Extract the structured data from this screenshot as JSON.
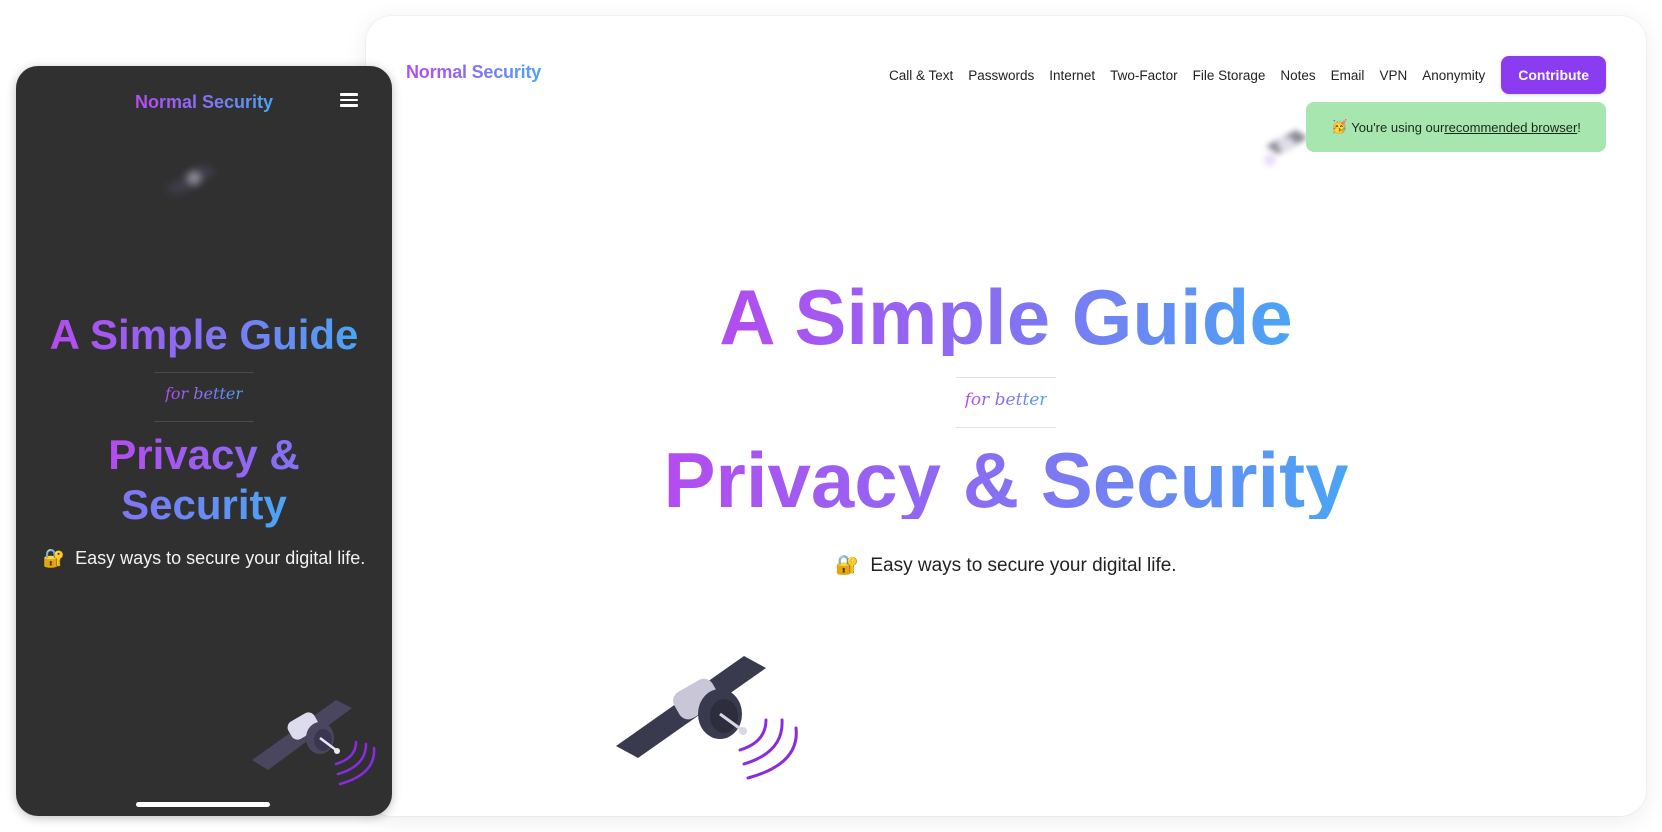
{
  "desktop": {
    "logo": "Normal Security",
    "nav": [
      "Call & Text",
      "Passwords",
      "Internet",
      "Two-Factor",
      "File Storage",
      "Notes",
      "Email",
      "VPN",
      "Anonymity"
    ],
    "contribute_label": "Contribute",
    "toast": {
      "emoji": "🥳",
      "prefix": "You're using our ",
      "link": "recommended browser",
      "suffix": "!"
    },
    "hero": {
      "title_line1": "A Simple Guide",
      "for_better": "for better",
      "title_line2": "Privacy & Security",
      "subtitle_emoji": "🔐",
      "subtitle": "Easy ways to secure your digital life."
    }
  },
  "mobile": {
    "logo": "Normal Security",
    "menu_icon": "hamburger-menu-icon",
    "hero": {
      "title_line1": "A Simple Guide",
      "for_better": "for better",
      "title_line2": "Privacy & Security",
      "subtitle_emoji": "🔐",
      "subtitle": "Easy ways to secure your digital life."
    }
  },
  "colors": {
    "gradient_start": "#b44cf0",
    "gradient_mid": "#8b6cf2",
    "gradient_end": "#4aa5f5",
    "contribute_bg": "#8b3cf0",
    "toast_bg": "#a8e6b0",
    "phone_bg": "#303030",
    "satellite_panel": "#3a3a4e",
    "signal_purple": "#8a2be2"
  }
}
